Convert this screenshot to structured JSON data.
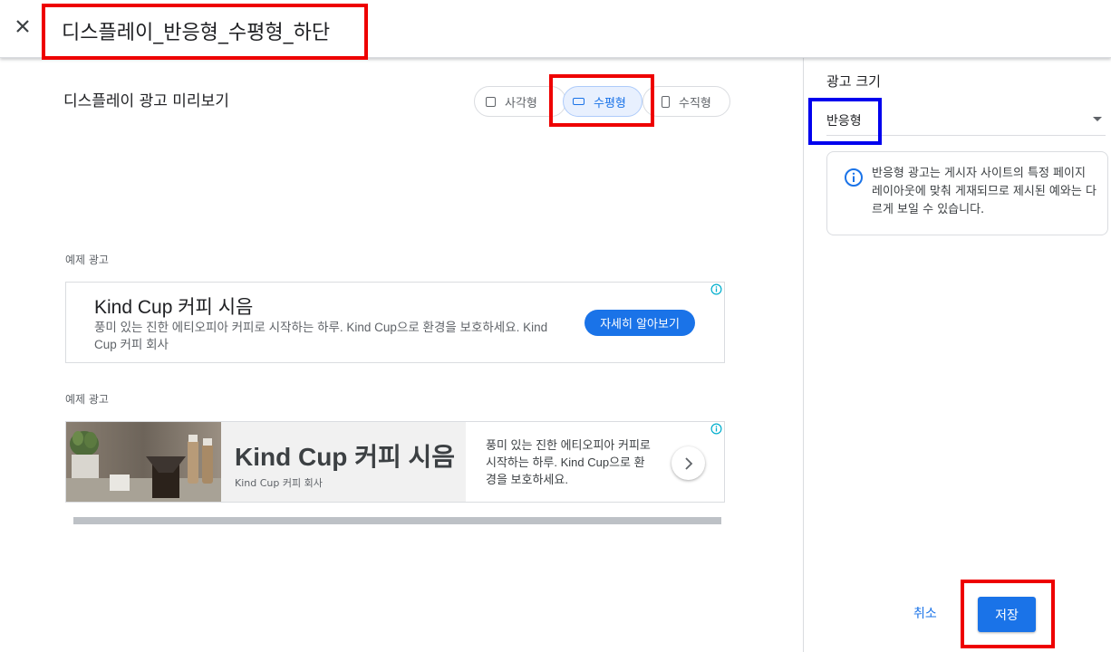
{
  "header": {
    "title": "디스플레이_반응형_수평형_하단",
    "close_icon": "close-icon"
  },
  "preview": {
    "title": "디스플레이 광고 미리보기",
    "toggles": [
      {
        "label": "사각형",
        "icon": "square-icon",
        "selected": false
      },
      {
        "label": "수평형",
        "icon": "horizontal-rectangle-icon",
        "selected": true
      },
      {
        "label": "수직형",
        "icon": "vertical-rectangle-icon",
        "selected": false
      }
    ]
  },
  "ads": [
    {
      "label": "예제 광고",
      "headline": "Kind Cup 커피 시음",
      "description": "풍미 있는 진한 에티오피아 커피로 시작하는 하루. Kind Cup으로 환경을 보호하세요. Kind Cup 커피 회사",
      "cta": "자세히 알아보기",
      "info_icon": "adchoices-info-icon"
    },
    {
      "label": "예제 광고",
      "headline": "Kind Cup 커피 시음",
      "company": "Kind Cup 커피 회사",
      "description": "풍미 있는 진한 에티오피아 커피로 시작하는 하루. Kind Cup으로 환경을 보호하세요.",
      "next_icon": "chevron-right-icon",
      "info_icon": "adchoices-info-icon"
    }
  ],
  "settings": {
    "size_label": "광고 크기",
    "size_value": "반응형",
    "info_text": "반응형 광고는 게시자 사이트의 특정 페이지 레이아웃에 맞춰 게재되므로 제시된 예와는 다르게 보일 수 있습니다."
  },
  "actions": {
    "cancel": "취소",
    "save": "저장"
  },
  "colors": {
    "accent": "#1a73e8",
    "highlight_red": "#ee0000",
    "highlight_blue": "#0000ee",
    "border": "#dadce0"
  }
}
